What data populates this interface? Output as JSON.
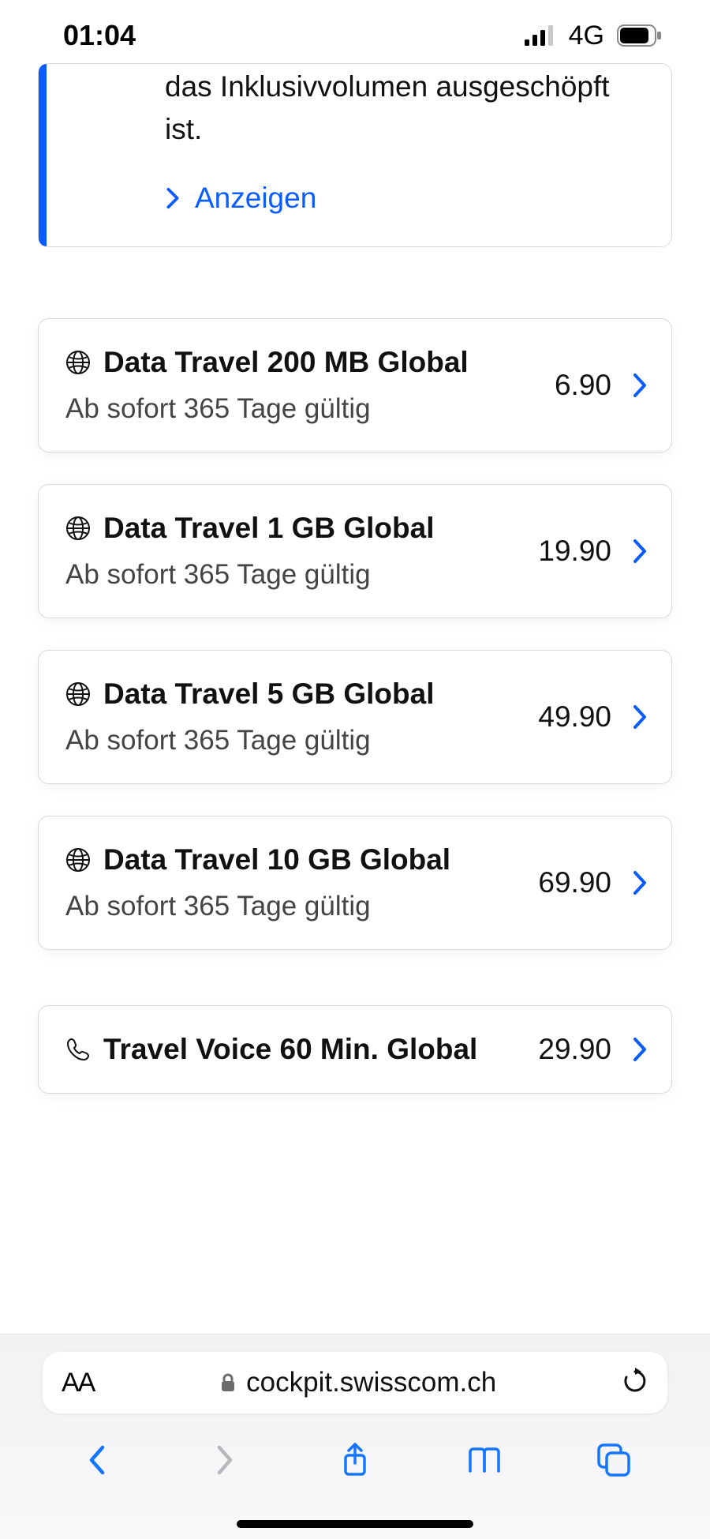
{
  "status": {
    "time": "01:04",
    "network": "4G"
  },
  "info": {
    "text": "das Inklusivvolumen ausgeschöpft ist.",
    "link": "Anzeigen"
  },
  "packs": [
    {
      "title": "Data Travel 200 MB Global",
      "sub": "Ab sofort 365 Tage gültig",
      "price": "6.90",
      "icon": "globe"
    },
    {
      "title": "Data Travel 1 GB Global",
      "sub": "Ab sofort 365 Tage gültig",
      "price": "19.90",
      "icon": "globe"
    },
    {
      "title": "Data Travel 5 GB Global",
      "sub": "Ab sofort 365 Tage gültig",
      "price": "49.90",
      "icon": "globe"
    },
    {
      "title": "Data Travel 10 GB Global",
      "sub": "Ab sofort 365 Tage gültig",
      "price": "69.90",
      "icon": "globe"
    }
  ],
  "voice": {
    "title": "Travel Voice 60 Min. Global",
    "price": "29.90"
  },
  "browser": {
    "domain": "cockpit.swisscom.ch"
  }
}
